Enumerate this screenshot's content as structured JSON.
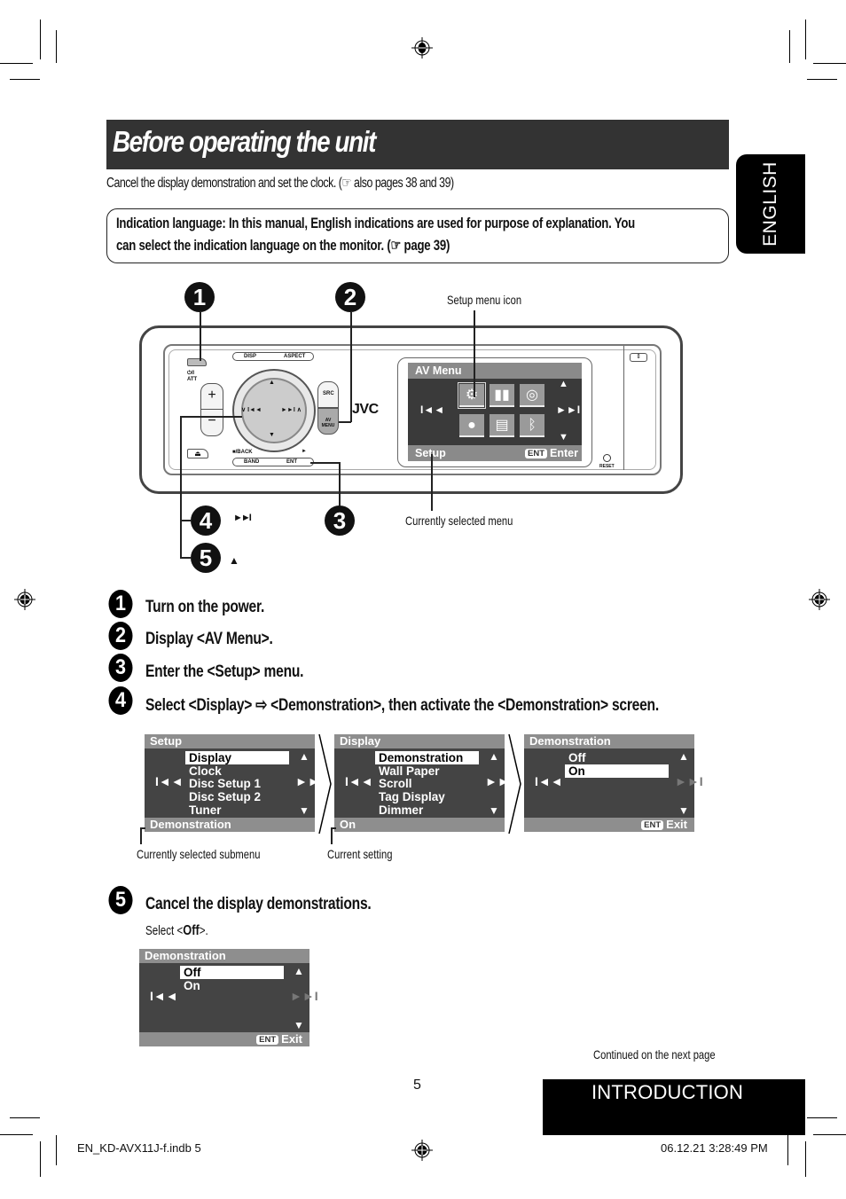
{
  "page": {
    "title": "Before operating the unit",
    "intro": "Cancel the display demonstration and set the clock. (☞ also pages 38 and 39)",
    "note": {
      "line1": "Indication language: In this manual, English indications are used for purpose of explanation. You",
      "line2": "can select the indication language on the monitor. (☞ page 39)"
    },
    "language_tab": "ENGLISH",
    "section_tab": "INTRODUCTION",
    "page_number": "5",
    "continued": "Continued on the next page",
    "footer_left": "EN_KD-AVX11J-f.indb   5",
    "footer_right": "06.12.21   3:28:49 PM"
  },
  "diagram": {
    "callouts": [
      "1",
      "2",
      "3",
      "4",
      "5"
    ],
    "callout4_symbol": "►►I",
    "callout5_symbol": "▲",
    "label_setup_icon": "Setup menu icon",
    "label_selected_menu": "Currently selected menu",
    "unit": {
      "brand": "JVC",
      "buttons": {
        "power": "⏻/I ATT",
        "disp": "DISP",
        "aspect": "ASPECT",
        "src": "SRC",
        "av_menu": "AV MENU",
        "band": "BAND",
        "ent": "ENT",
        "back": "■/BACK",
        "play": "►",
        "plus": "+",
        "minus": "−",
        "eject": "⏏",
        "reset": "RESET",
        "knob_left": "∨ I◄◄",
        "knob_right": "►►I ∧",
        "knob_up": "▲",
        "knob_down": "▼"
      },
      "screen": {
        "header": "AV Menu",
        "footer": "Setup",
        "ent": "ENT",
        "enter": "Enter",
        "prev": "I◄◄",
        "next": "►►I",
        "up": "▲",
        "down": "▼",
        "icons": [
          "setup-gears",
          "equalizer-bars",
          "speaker",
          "dimmer-dial",
          "list-document",
          "bluetooth"
        ]
      }
    }
  },
  "steps": [
    {
      "num": "1",
      "text": "Turn on the power."
    },
    {
      "num": "2",
      "text": "Display <AV Menu>."
    },
    {
      "num": "3",
      "text": "Enter the <Setup> menu."
    },
    {
      "num": "4",
      "text": "Select <Display> ⇨ <Demonstration>, then activate the <Demonstration> screen."
    },
    {
      "num": "5",
      "text": "Cancel the display demonstrations."
    }
  ],
  "step5_sub": {
    "prefix": "Select <",
    "value": "Off",
    "suffix": ">."
  },
  "screens": {
    "setup": {
      "header": "Setup",
      "items": [
        "Display",
        "Clock",
        "Disc Setup 1",
        "Disc Setup 2",
        "Tuner"
      ],
      "selected": 0,
      "footer": "Demonstration"
    },
    "display": {
      "header": "Display",
      "items": [
        "Demonstration",
        "Wall Paper",
        "Scroll",
        "Tag Display",
        "Dimmer"
      ],
      "selected": 0,
      "footer": "On"
    },
    "demo_on": {
      "header": "Demonstration",
      "items": [
        "Off",
        "On"
      ],
      "selected": 1,
      "ent": "ENT",
      "footer_action": "Exit"
    },
    "demo_off": {
      "header": "Demonstration",
      "items": [
        "Off",
        "On"
      ],
      "selected": 0,
      "ent": "ENT",
      "footer_action": "Exit"
    },
    "nav": {
      "prev": "I◄◄",
      "next": "►►I",
      "up": "▲",
      "down": "▼"
    },
    "label_submenu": "Currently selected submenu",
    "label_setting": "Current setting"
  }
}
